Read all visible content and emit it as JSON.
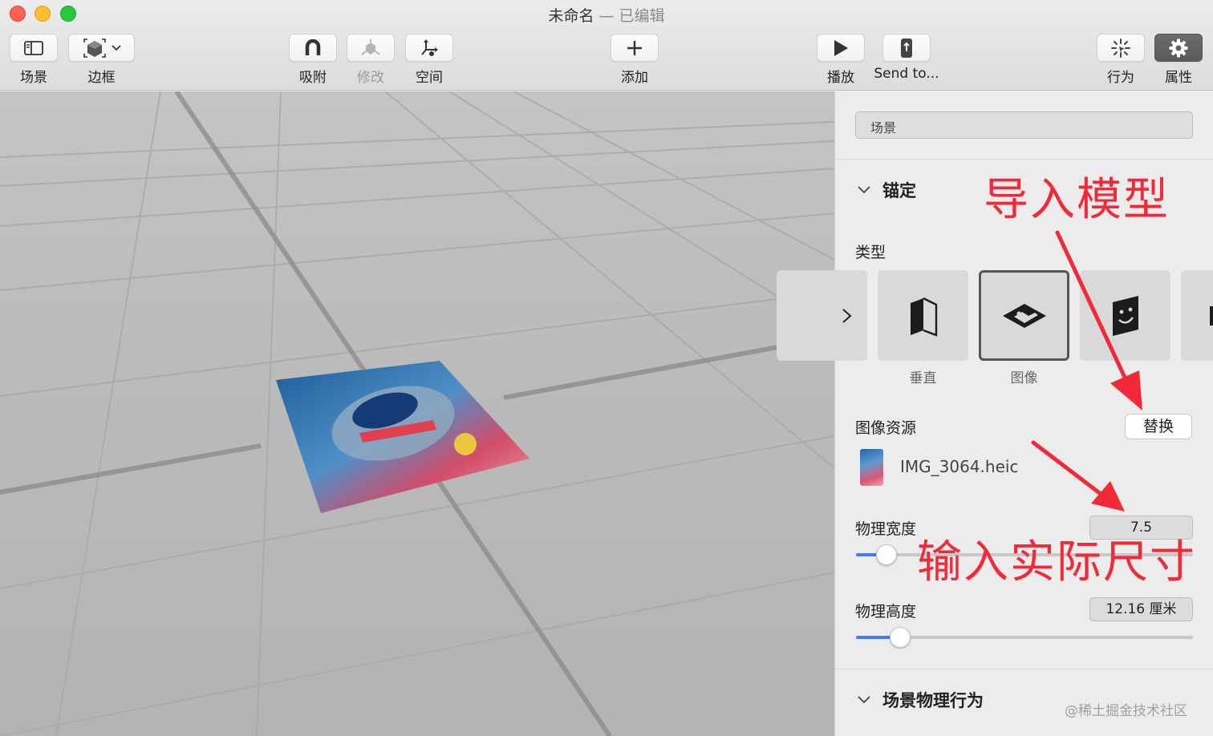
{
  "window": {
    "title": "未命名",
    "separator": " — ",
    "status": "已编辑"
  },
  "toolbar": {
    "scene_label": "场景",
    "bounds_label": "边框",
    "snap_label": "吸附",
    "modify_label": "修改",
    "space_label": "空间",
    "add_label": "添加",
    "play_label": "播放",
    "send_label": "Send to...",
    "behaviors_label": "行为",
    "properties_label": "属性"
  },
  "inspector": {
    "name_field": "场景",
    "anchor_section": "锚定",
    "type_label": "类型",
    "type_options": [
      {
        "label": "垂直",
        "icon": "vertical-anchor-icon"
      },
      {
        "label": "图像",
        "icon": "image-anchor-icon",
        "selected": true
      },
      {
        "label": "",
        "icon": "face-anchor-icon"
      }
    ],
    "image_asset_label": "图像资源",
    "replace_button": "替换",
    "asset_filename": "IMG_3064.heic",
    "width_label": "物理宽度",
    "width_value": "7.5",
    "width_slider_fraction": 0.09,
    "height_label": "物理高度",
    "height_value": "12.16 厘米",
    "height_slider_fraction": 0.13,
    "physics_section": "场景物理行为",
    "watermark": "@稀土掘金技术社区"
  },
  "annotations": {
    "import_model": "导入模型",
    "enter_size": "输入实际尺寸",
    "color": "#f22a37"
  },
  "accent_color": "#3d7ef5"
}
